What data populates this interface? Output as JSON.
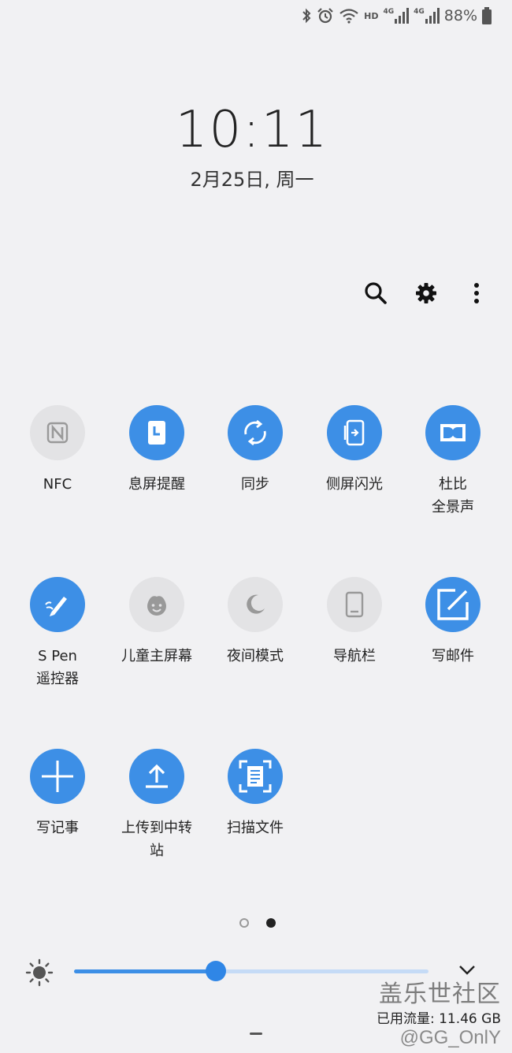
{
  "status_bar": {
    "network_label": "HD",
    "signal1_label": "4G",
    "signal2_label": "4G",
    "battery_text": "88%"
  },
  "clock": {
    "time": "10:11",
    "date": "2月25日, 周一"
  },
  "top_actions": [
    "search-icon",
    "gear-icon",
    "more-vertical-icon"
  ],
  "tiles": [
    {
      "label": "NFC",
      "icon": "nfc-icon",
      "on": false
    },
    {
      "label": "息屏提醒",
      "icon": "always-on-display-icon",
      "on": true
    },
    {
      "label": "同步",
      "icon": "sync-icon",
      "on": true
    },
    {
      "label": "侧屏闪光",
      "icon": "edge-lighting-icon",
      "on": true
    },
    {
      "label": "杜比\n全景声",
      "icon": "dolby-icon",
      "on": true
    },
    {
      "label": "S Pen\n遥控器",
      "icon": "spen-icon",
      "on": true
    },
    {
      "label": "儿童主屏幕",
      "icon": "kids-home-icon",
      "on": false
    },
    {
      "label": "夜间模式",
      "icon": "moon-icon",
      "on": false
    },
    {
      "label": "导航栏",
      "icon": "navigation-bar-icon",
      "on": false
    },
    {
      "label": "写邮件",
      "icon": "compose-email-icon",
      "on": true
    },
    {
      "label": "写记事",
      "icon": "plus-icon",
      "on": true
    },
    {
      "label": "上传到中转\n站",
      "icon": "upload-icon",
      "on": true
    },
    {
      "label": "扫描文件",
      "icon": "scan-document-icon",
      "on": true
    }
  ],
  "pager": {
    "pages": 2,
    "current": 2
  },
  "brightness": {
    "level": 0.4
  },
  "watermark": {
    "title": "盖乐世社区",
    "usage": "已用流量: 11.46 GB",
    "user": "@GG_OnlY"
  },
  "colors": {
    "accent": "#3d8fe6",
    "tile_off": "#e3e3e5",
    "background": "#f1f1f3"
  }
}
